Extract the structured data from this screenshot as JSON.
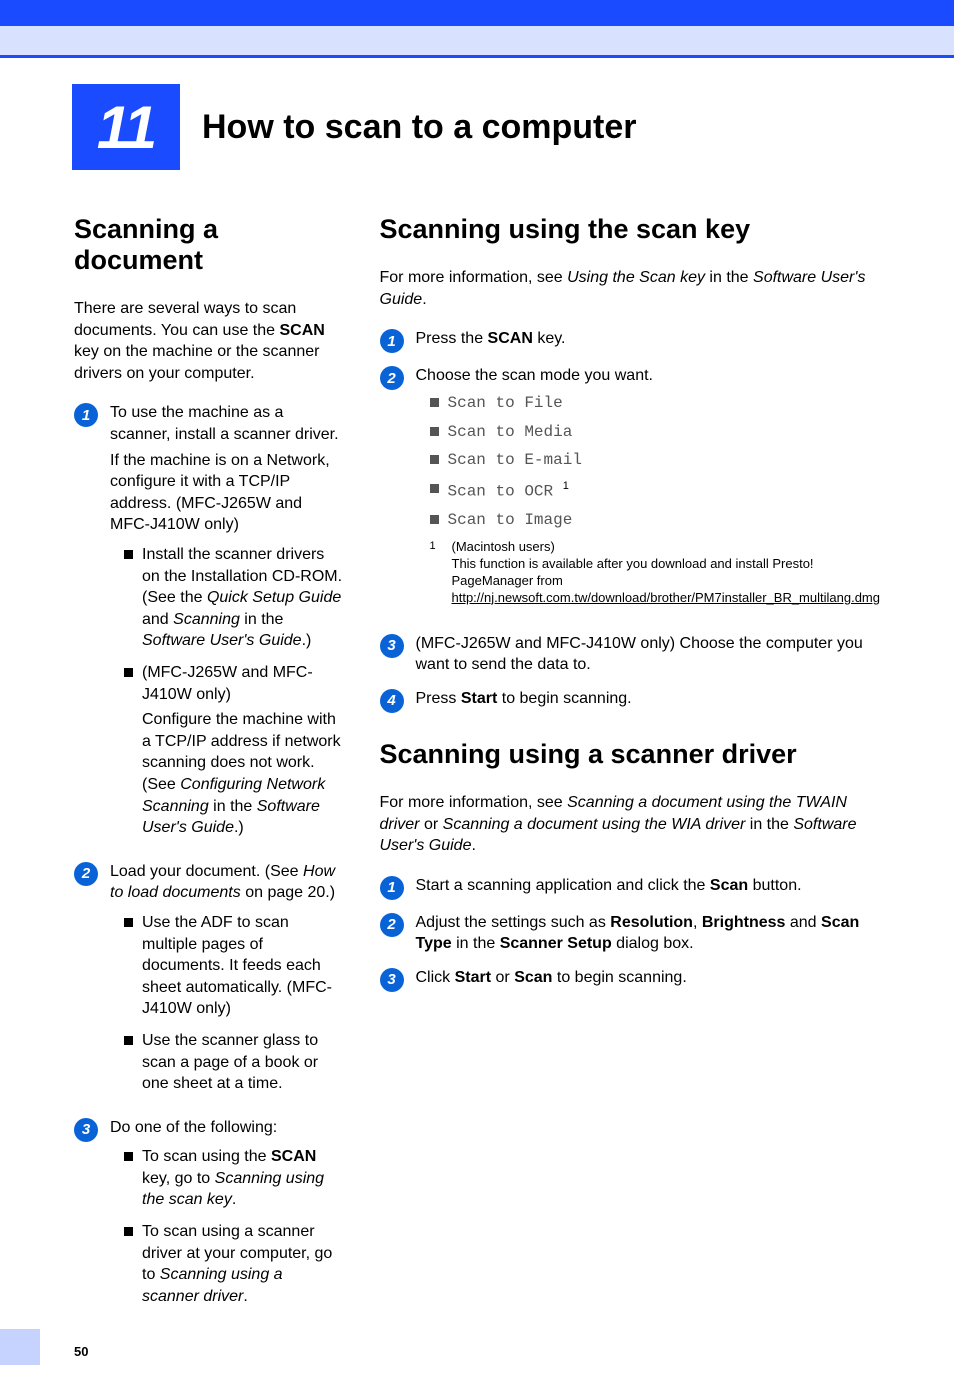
{
  "chapter": {
    "number": "11",
    "title": "How to scan to a computer"
  },
  "page_number": "50",
  "left": {
    "h": "Scanning a document",
    "intro_pre": "There are several ways to scan documents. You can use the ",
    "intro_bold": "SCAN",
    "intro_post": " key on the machine or the scanner drivers on your computer.",
    "s1_a": "To use the machine as a scanner, install a scanner driver.",
    "s1_b": "If the machine is on a Network, configure it with a TCP/IP address. (MFC-J265W and MFC-J410W only)",
    "s1_b1_pre": "Install the scanner drivers on the Installation CD-ROM. (See the ",
    "s1_b1_i1": "Quick Setup Guide",
    "s1_b1_mid": " and ",
    "s1_b1_i2": "Scanning",
    "s1_b1_mid2": " in the ",
    "s1_b1_i3": "Software User's Guide",
    "s1_b1_post": ".)",
    "s1_b2_a": " (MFC-J265W and MFC-J410W only)",
    "s1_b2_b_pre": "Configure the machine with a TCP/IP address if network scanning does not work. (See ",
    "s1_b2_b_i1": "Configuring Network Scanning",
    "s1_b2_b_mid": " in the ",
    "s1_b2_b_i2": "Software User's Guide",
    "s1_b2_b_post": ".)",
    "s2_pre": "Load your document. (See ",
    "s2_i": "How to load documents",
    "s2_post": " on page 20.)",
    "s2_b1": "Use the ADF to scan multiple pages of documents. It feeds each sheet automatically. (MFC-J410W only)",
    "s2_b2": "Use the scanner glass to scan a page of a book or one sheet at a time.",
    "s3_head": "Do one of the following:",
    "s3_b1_pre": "To scan using the ",
    "s3_b1_bold": "SCAN",
    "s3_b1_mid": " key, go to ",
    "s3_b1_i": "Scanning using the scan key",
    "s3_b1_post": ".",
    "s3_b2_pre": "To scan using a scanner driver at your computer, go to ",
    "s3_b2_i": "Scanning using a scanner driver",
    "s3_b2_post": "."
  },
  "rightA": {
    "h": "Scanning using the scan key",
    "intro_pre": "For more information, see ",
    "intro_i": "Using the Scan key",
    "intro_mid": " in the ",
    "intro_i2": "Software User's Guide",
    "intro_post": ".",
    "s1_pre": "Press the ",
    "s1_bold": "SCAN",
    "s1_post": " key.",
    "s2": "Choose the scan mode you want.",
    "opt1": "Scan to File",
    "opt2": "Scan to Media",
    "opt3": "Scan to E-mail",
    "opt4": "Scan to OCR",
    "opt4_sup": "1",
    "opt5": "Scan to Image",
    "fnum": "1",
    "fnote_a": "(Macintosh users)",
    "fnote_b": "This function is available after you download and install Presto! PageManager from ",
    "fnote_link": "http://nj.newsoft.com.tw/download/brother/PM7installer_BR_multilang.dmg",
    "s3": "(MFC-J265W and MFC-J410W only) Choose the computer you want to send the data to.",
    "s4_pre": "Press ",
    "s4_bold": "Start",
    "s4_post": " to begin scanning."
  },
  "rightB": {
    "h": "Scanning using a scanner driver",
    "intro_pre": "For more information, see ",
    "intro_i1": "Scanning a document using the TWAIN driver",
    "intro_mid1": " or ",
    "intro_i2": "Scanning a document using the WIA driver",
    "intro_mid2": " in the ",
    "intro_i3": "Software User's Guide",
    "intro_post": ".",
    "s1_pre": "Start a scanning application and click the ",
    "s1_bold": "Scan",
    "s1_post": " button.",
    "s2_pre": "Adjust the settings such as ",
    "s2_b1": "Resolution",
    "s2_mid1": ", ",
    "s2_b2": "Brightness",
    "s2_mid2": " and ",
    "s2_b3": "Scan Type",
    "s2_mid3": " in the ",
    "s2_b4": "Scanner Setup",
    "s2_post": " dialog box.",
    "s3_pre": "Click ",
    "s3_b1": "Start",
    "s3_mid": " or ",
    "s3_b2": "Scan",
    "s3_post": " to begin scanning."
  }
}
